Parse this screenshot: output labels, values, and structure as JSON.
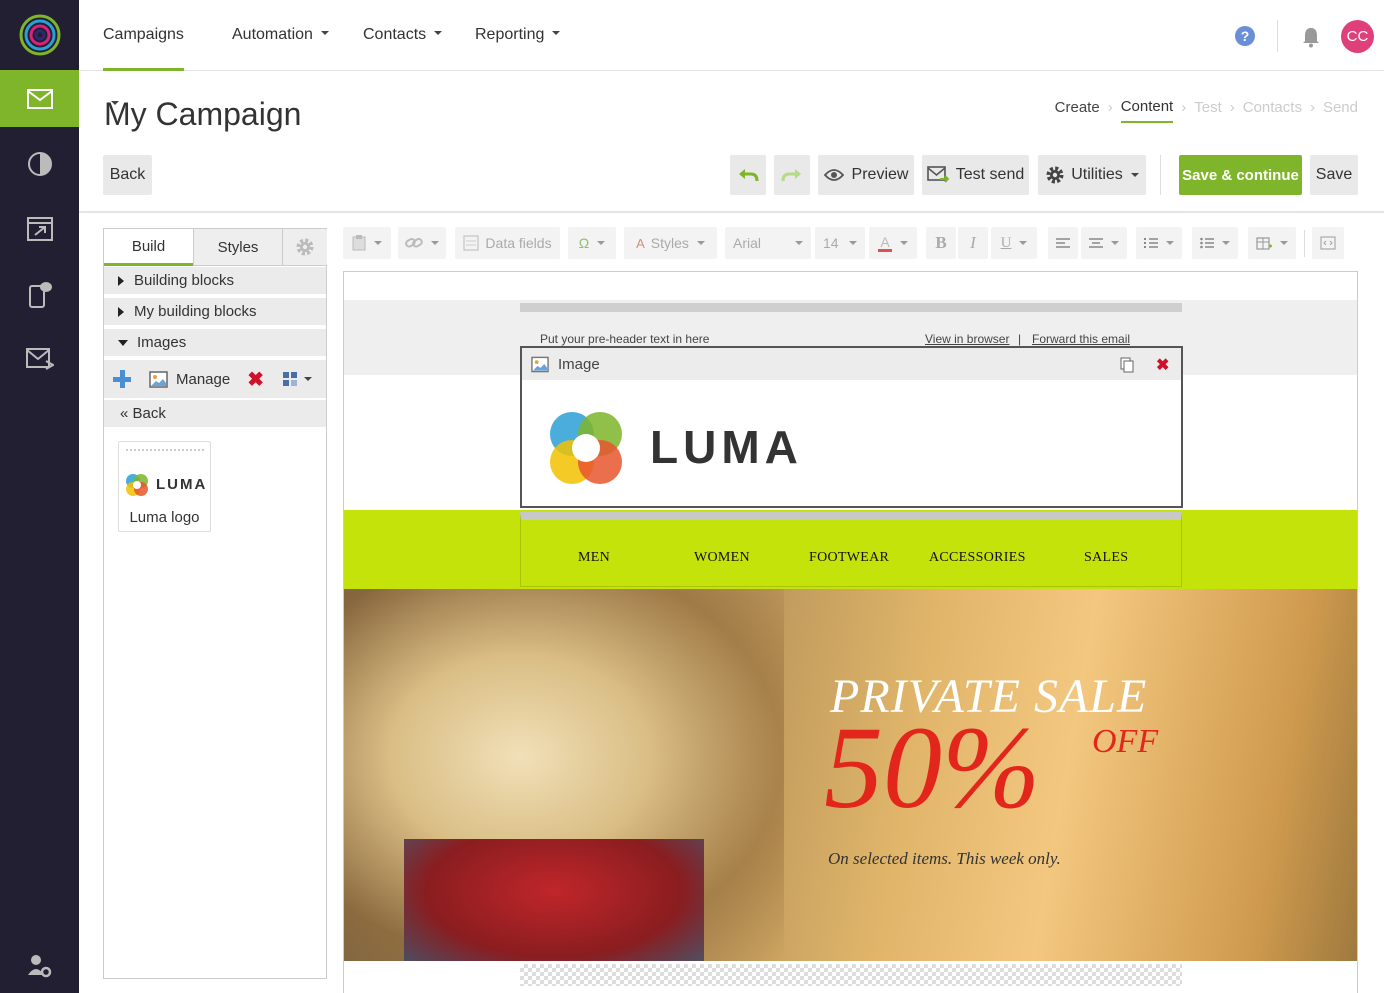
{
  "nav": {
    "items": [
      {
        "label": "Campaigns"
      },
      {
        "label": "Automation"
      },
      {
        "label": "Contacts"
      },
      {
        "label": "Reporting"
      }
    ],
    "help_glyph": "?",
    "avatar_initials": "CC"
  },
  "rail": {
    "icons": [
      "logo-icon",
      "email-icon",
      "reports-icon",
      "automation-icon",
      "mobile-icon",
      "inbox-icon",
      "user-settings-icon"
    ],
    "active_color": "#7eb52a",
    "bg_color": "#231f33"
  },
  "header": {
    "title": "My Campaign",
    "steps": [
      {
        "label": "Create",
        "state": "done"
      },
      {
        "label": "Content",
        "state": "current"
      },
      {
        "label": "Test",
        "state": "todo"
      },
      {
        "label": "Contacts",
        "state": "todo"
      },
      {
        "label": "Send",
        "state": "todo"
      }
    ],
    "back_label": "Back",
    "preview_label": "Preview",
    "test_send_label": "Test send",
    "utilities_label": "Utilities",
    "save_continue_label": "Save & continue",
    "save_label": "Save"
  },
  "panel": {
    "tabs": {
      "build": "Build",
      "styles": "Styles"
    },
    "sections": [
      {
        "label": "Building blocks",
        "expanded": false
      },
      {
        "label": "My building blocks",
        "expanded": false
      },
      {
        "label": "Images",
        "expanded": true
      }
    ],
    "manage_label": "Manage",
    "back_label": "« Back",
    "thumb": {
      "label": "Luma logo",
      "brand": "LUMA"
    }
  },
  "toolbar": {
    "data_fields_label": "Data fields",
    "styles_label": "Styles",
    "font_label": "Arial",
    "size_label": "14",
    "omega_glyph": "Ω"
  },
  "canvas": {
    "preheader_text": "Put your pre-header text in here",
    "view_browser_label": "View in browser",
    "link_divider": "|",
    "forward_label": "Forward this email",
    "image_block_label": "Image",
    "brand": "LUMA",
    "menu": [
      "MEN",
      "WOMEN",
      "FOOTWEAR",
      "ACCESSORIES",
      "SALES"
    ],
    "hero": {
      "title": "PRIVATE SALE",
      "percent": "50%",
      "off": "OFF",
      "subtitle": "On selected items. This week only."
    },
    "nav_band_color": "#c4e30b",
    "sale_color": "#e2261b"
  }
}
